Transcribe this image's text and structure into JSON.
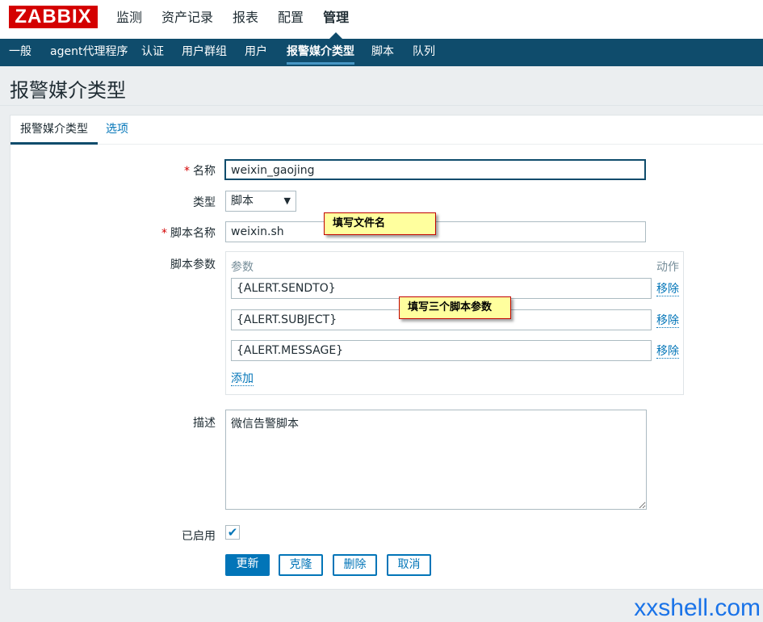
{
  "brand": {
    "logo": "ZABBIX"
  },
  "main_menu": [
    "监测",
    "资产记录",
    "报表",
    "配置",
    "管理"
  ],
  "sub_menu": [
    "一般",
    "agent代理程序",
    "认证",
    "用户群组",
    "用户",
    "报警媒介类型",
    "脚本",
    "队列"
  ],
  "page": {
    "title": "报警媒介类型"
  },
  "tabs": {
    "media_type": "报警媒介类型",
    "options": "选项"
  },
  "form": {
    "name_label": "名称",
    "name_value": "weixin_gaojing",
    "type_label": "类型",
    "type_value": "脚本",
    "script_name_label": "脚本名称",
    "script_name_value": "weixin.sh",
    "script_params_label": "脚本参数",
    "params_header": "参数",
    "action_header": "动作",
    "params": [
      "{ALERT.SENDTO}",
      "{ALERT.SUBJECT}",
      "{ALERT.MESSAGE}"
    ],
    "remove_label": "移除",
    "add_label": "添加",
    "description_label": "描述",
    "description_value": "微信告警脚本",
    "enabled_label": "已启用",
    "enabled_checked": "✔"
  },
  "buttons": {
    "update": "更新",
    "clone": "克隆",
    "delete": "删除",
    "cancel": "取消"
  },
  "annotations": {
    "file_name_note": "填写文件名",
    "params_note": "填写三个脚本参数"
  },
  "watermark": "xxshell.com",
  "colors": {
    "nav_dark": "#0f4c6c",
    "link_blue": "#0275b8",
    "brand_red": "#d40000"
  }
}
